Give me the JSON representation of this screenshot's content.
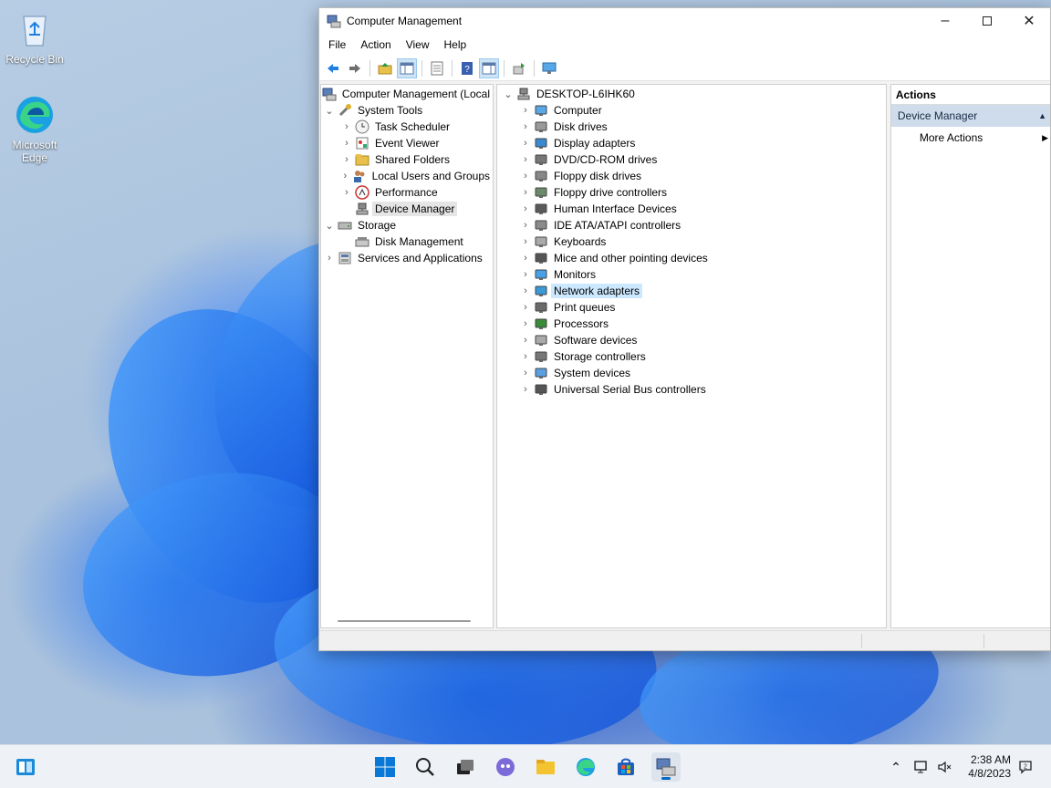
{
  "desktop": {
    "icons": [
      {
        "label": "Recycle Bin",
        "icon": "recycle-bin-icon"
      },
      {
        "label": "Microsoft Edge",
        "icon": "edge-icon"
      }
    ]
  },
  "window": {
    "title": "Computer Management",
    "controls": {
      "minimize": "minimize-icon",
      "maximize": "maximize-icon",
      "close": "close-icon"
    }
  },
  "menu": [
    "File",
    "Action",
    "View",
    "Help"
  ],
  "toolbar": [
    "back-arrow-icon",
    "forward-arrow-icon",
    "up-folder-icon",
    "show-hide-tree-icon",
    "properties-icon",
    "help-icon",
    "show-hide-action-pane-icon",
    "update-driver-icon",
    "scan-hardware-icon"
  ],
  "left_tree": {
    "root": "Computer Management (Local",
    "system_tools": "System Tools",
    "task_scheduler": "Task Scheduler",
    "event_viewer": "Event Viewer",
    "shared_folders": "Shared Folders",
    "local_users": "Local Users and Groups",
    "performance": "Performance",
    "device_manager": "Device Manager",
    "storage": "Storage",
    "disk_management": "Disk Management",
    "services": "Services and Applications"
  },
  "devices": {
    "host": "DESKTOP-L6IHK60",
    "items": [
      "Computer",
      "Disk drives",
      "Display adapters",
      "DVD/CD-ROM drives",
      "Floppy disk drives",
      "Floppy drive controllers",
      "Human Interface Devices",
      "IDE ATA/ATAPI controllers",
      "Keyboards",
      "Mice and other pointing devices",
      "Monitors",
      "Network adapters",
      "Print queues",
      "Processors",
      "Software devices",
      "Storage controllers",
      "System devices",
      "Universal Serial Bus controllers"
    ],
    "highlighted": "Network adapters"
  },
  "actions": {
    "header": "Actions",
    "section": "Device Manager",
    "more": "More Actions"
  },
  "taskbar": {
    "clock_time": "2:38 AM",
    "clock_date": "4/8/2023",
    "apps": [
      "widgets-icon",
      "start-icon",
      "search-icon",
      "task-view-icon",
      "chat-icon",
      "file-explorer-icon",
      "edge-icon",
      "store-icon",
      "computer-management-icon"
    ]
  },
  "colors": {
    "accent": "#0067c0",
    "selection": "#cce8ff",
    "action_section": "#cfdcec"
  }
}
